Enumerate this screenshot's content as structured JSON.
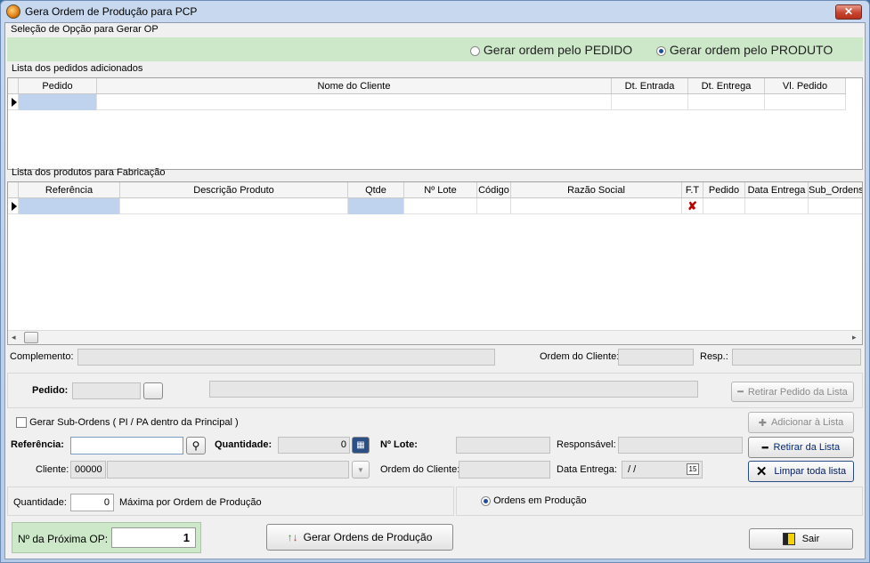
{
  "window": {
    "title": "Gera Ordem de Produção para PCP",
    "close_label": "✕"
  },
  "selecao": {
    "group_label": "Seleção de Opção para Gerar OP",
    "opt_pedido": "Gerar ordem pelo PEDIDO",
    "opt_produto": "Gerar ordem pelo PRODUTO",
    "selected": "produto"
  },
  "pedidos": {
    "group_label": "Lista dos pedidos adicionados",
    "columns": [
      "Pedido",
      "Nome do Cliente",
      "Dt. Entrada",
      "Dt. Entrega",
      "Vl. Pedido"
    ]
  },
  "produtos": {
    "group_label": "Lista dos produtos para Fabricação",
    "columns": [
      "Referência",
      "Descrição Produto",
      "Qtde",
      "Nº Lote",
      "Código",
      "Razão Social",
      "F.T",
      "Pedido",
      "Data Entrega",
      "Sub_Ordens"
    ]
  },
  "complemento": {
    "label": "Complemento:",
    "ordem_cliente_label": "Ordem do Cliente:",
    "resp_label": "Resp.:"
  },
  "pedido_row": {
    "label": "Pedido:",
    "retirar_pedido_label": "Retirar Pedido da Lista"
  },
  "form": {
    "sub_ordens_label": "Gerar Sub-Ordens  ( PI / PA dentro da Principal )",
    "adicionar_label": "Adicionar à Lista",
    "referencia_label": "Referência:",
    "quantidade_label": "Quantidade:",
    "quantidade_value": "0",
    "lote_label": "Nº Lote:",
    "responsavel_label": "Responsável:",
    "retirar_lista_label": "Retirar da Lista",
    "cliente_label": "Cliente:",
    "cliente_code": "00000",
    "ordem_cliente_label": "Ordem do Cliente:",
    "data_entrega_label": "Data Entrega:",
    "data_entrega_value": "/ /",
    "limpar_label": "Limpar toda lista"
  },
  "bottom": {
    "quantidade_label": "Quantidade:",
    "quantidade_value": "0",
    "maxima_label": "Máxima por Ordem de Produção",
    "ordens_label": "Ordens em Produção",
    "proxima_label": "Nº da Próxima OP:",
    "proxima_value": "1",
    "gerar_label": "Gerar Ordens de Produção",
    "sair_label": "Sair"
  }
}
